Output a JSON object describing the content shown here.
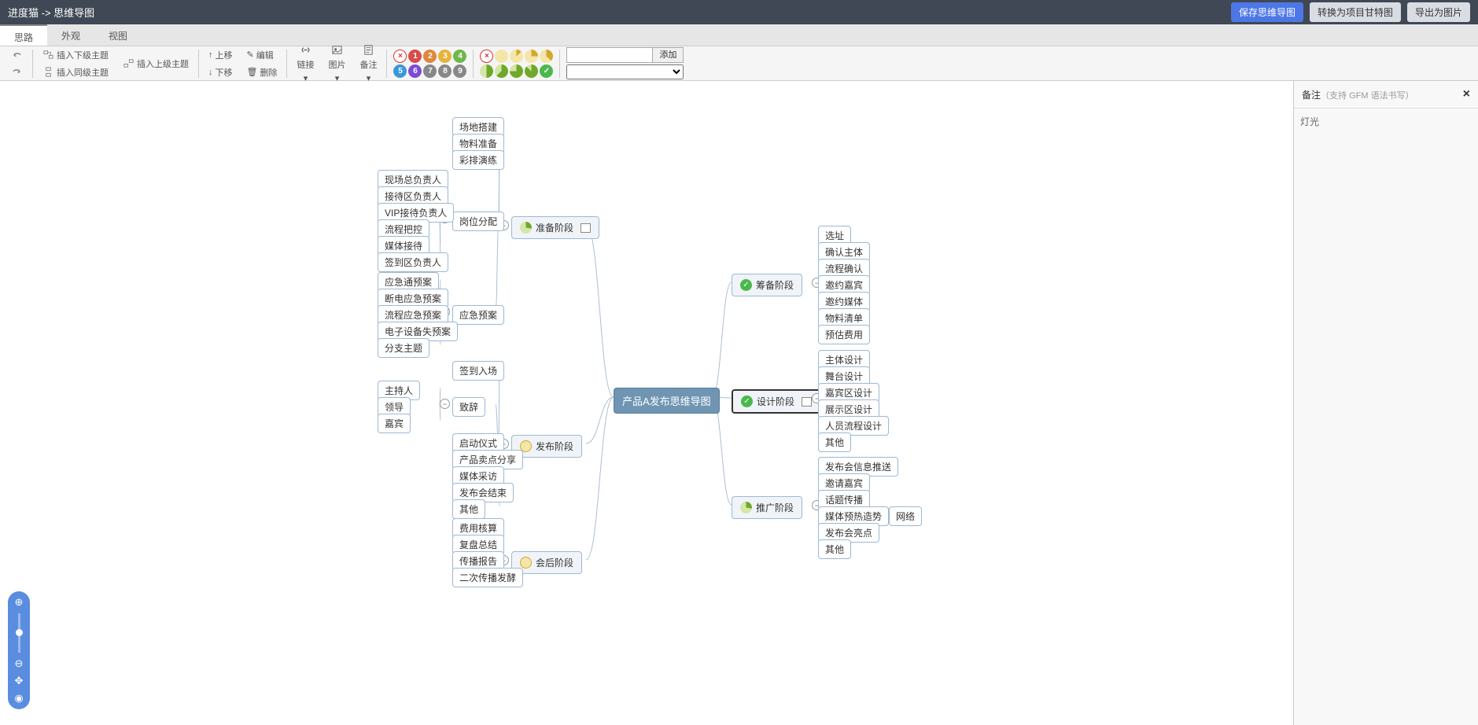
{
  "header": {
    "title": "进度猫 -> 思维导图",
    "save": "保存思维导图",
    "gantt": "转换为项目甘特图",
    "export": "导出为图片"
  },
  "tabs": [
    "思路",
    "外观",
    "视图"
  ],
  "toolbar": {
    "insert_child": "插入下级主题",
    "insert_parent": "插入上级主题",
    "insert_sibling": "插入同级主题",
    "up": "上移",
    "down": "下移",
    "edit": "编辑",
    "delete": "删除",
    "link": "链接",
    "image": "图片",
    "note": "备注",
    "add": "添加"
  },
  "priority_colors": [
    "#d84b4b",
    "#e0863c",
    "#e6b43c",
    "#6fb84b",
    "#3b98d8",
    "#7a4bd8",
    "#888",
    "#888",
    "#888",
    "#888"
  ],
  "progress_colors_top": [
    "#f3d24b",
    "#f3d24b",
    "#f3d24b",
    "#f3d24b",
    "#f3d24b"
  ],
  "progress_colors_bot": [
    "#8fc94b",
    "#8fc94b",
    "#8fc94b",
    "#8fc94b",
    "#4bb84b"
  ],
  "sidebar": {
    "title": "备注",
    "sub": "（支持 GFM 语法书写）",
    "content": "灯光"
  },
  "map": {
    "root": "产品A发布思维导图",
    "right": [
      {
        "label": "筹备阶段",
        "icon": "check",
        "children": [
          "选址",
          "确认主体",
          "流程确认",
          "邀约嘉宾",
          "邀约媒体",
          "物料清单",
          "预估费用"
        ]
      },
      {
        "label": "设计阶段",
        "icon": "check",
        "note": true,
        "selected": true,
        "children": [
          "主体设计",
          "舞台设计",
          "嘉宾区设计",
          "展示区设计",
          "人员流程设计",
          "其他"
        ]
      },
      {
        "label": "推广阶段",
        "icon": "pie",
        "children": [
          "发布会信息推送",
          "邀请嘉宾",
          "话题传播",
          "媒体预热造势",
          "发布会亮点",
          "其他"
        ],
        "extra": "网络"
      }
    ],
    "left": [
      {
        "label": "准备阶段",
        "icon": "pie",
        "note": true,
        "children_groups": [
          {
            "items": [
              "场地搭建",
              "物料准备",
              "彩排演练"
            ]
          },
          {
            "label": "岗位分配",
            "items": [
              "现场总负责人",
              "接待区负责人",
              "VIP接待负责人",
              "流程把控",
              "媒体接待",
              "签到区负责人"
            ]
          },
          {
            "label": "应急预案",
            "items": [
              "应急通预案",
              "断电应急预案",
              "流程应急预案",
              "电子设备失预案",
              "分支主题"
            ]
          }
        ]
      },
      {
        "label": "发布阶段",
        "icon": "yellow",
        "children_groups": [
          {
            "items": [
              "签到入场"
            ]
          },
          {
            "label": "致辞",
            "items": [
              "主持人",
              "领导",
              "嘉宾"
            ]
          },
          {
            "items": [
              "启动仪式",
              "产品卖点分享",
              "媒体采访",
              "发布会结束",
              "其他"
            ]
          }
        ]
      },
      {
        "label": "会后阶段",
        "icon": "yellow",
        "children_groups": [
          {
            "items": [
              "费用核算",
              "复盘总结",
              "传播报告",
              "二次传播发酵"
            ]
          }
        ]
      }
    ]
  }
}
